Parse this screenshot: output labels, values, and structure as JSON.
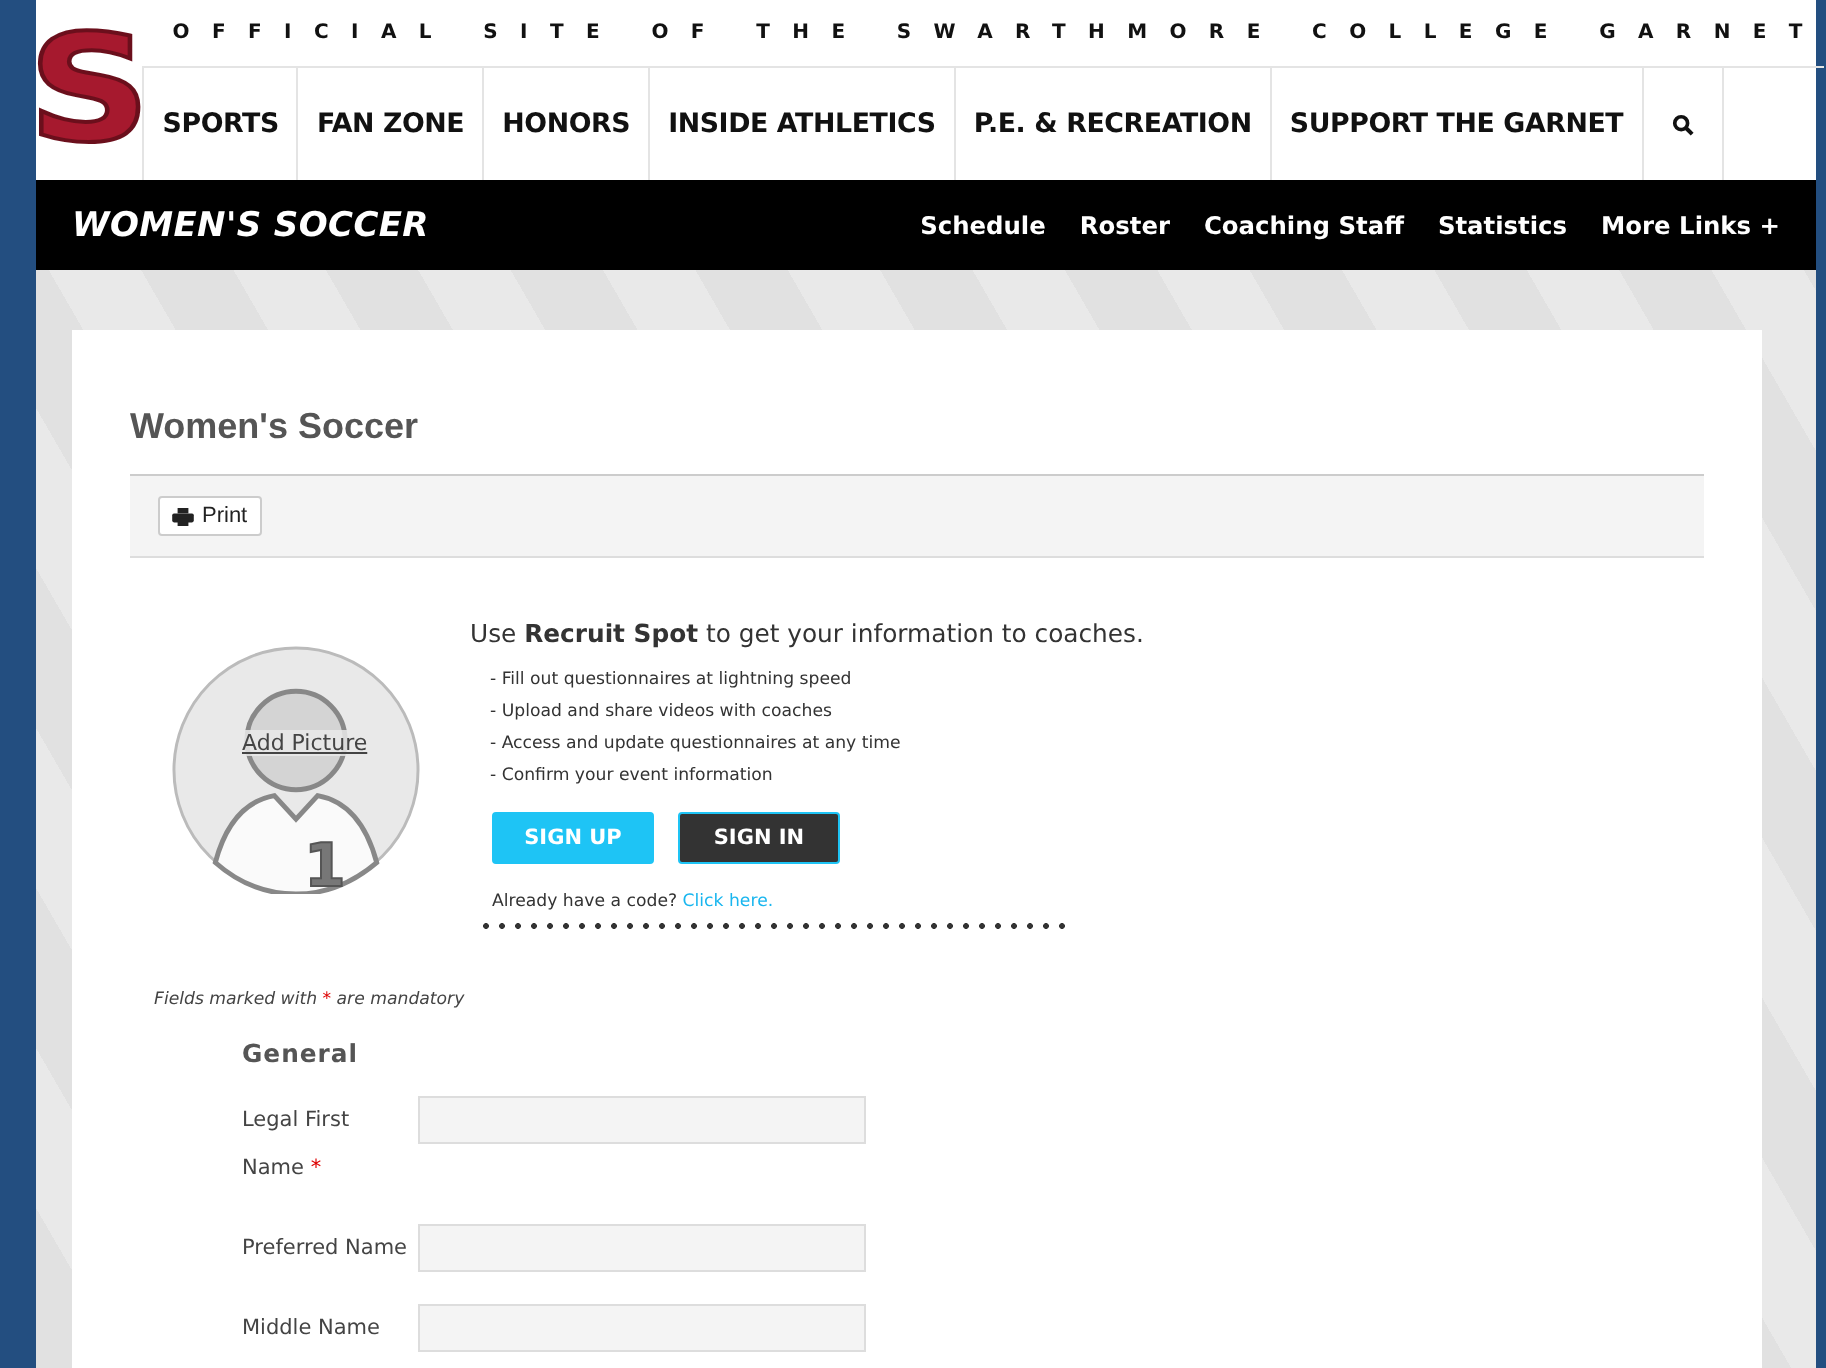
{
  "tagline": "OFFICIAL SITE OF THE SWARTHMORE COLLEGE GARNET",
  "logo": "S",
  "main_nav": [
    {
      "label": "SPORTS"
    },
    {
      "label": "FAN ZONE"
    },
    {
      "label": "HONORS"
    },
    {
      "label": "INSIDE ATHLETICS"
    },
    {
      "label": "P.E. & RECREATION"
    },
    {
      "label": "SUPPORT THE GARNET"
    }
  ],
  "sport_bar": {
    "title": "WOMEN'S SOCCER",
    "links": [
      "Schedule",
      "Roster",
      "Coaching Staff",
      "Statistics",
      "More Links +"
    ]
  },
  "page_title": "Women's Soccer",
  "toolbar": {
    "print_button": "Print"
  },
  "recruit": {
    "add_picture": "Add Picture",
    "jersey_number": "1",
    "headline": "Use **Recruit Spot** to get your information to coaches.",
    "bullets": [
      "- Fill out questionnaires at lightning speed",
      "- Upload and share videos with coaches",
      "- Access and update questionnaires at any time",
      "- Confirm your event information"
    ],
    "sign_up": "SIGN UP",
    "sign_in": "SIGN IN",
    "code_prompt": "Already have a code?",
    "code_link": "Click here."
  },
  "form": {
    "note_before": "Fields marked with",
    "note_mark": "*",
    "note_after": "are mandatory",
    "section": "General",
    "fields": [
      {
        "label": "Legal First Name",
        "required_mark": "*"
      },
      {
        "label": "Preferred Name"
      },
      {
        "label": "Middle Name"
      }
    ]
  }
}
